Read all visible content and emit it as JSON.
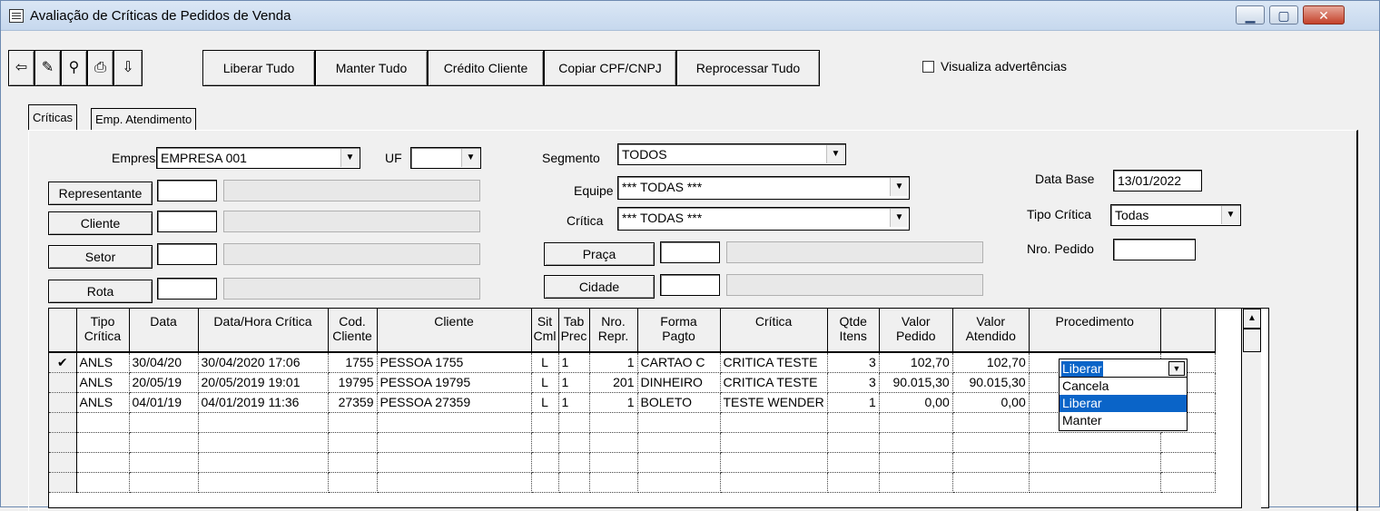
{
  "window": {
    "title": "Avaliação de Críticas de Pedidos de Venda",
    "controls": [
      "minimize-icon",
      "maximize-icon",
      "close-icon"
    ]
  },
  "toolbar": {
    "icons": [
      "exit-icon",
      "edit-icon",
      "binoculars-icon",
      "printer-icon",
      "export-icon"
    ],
    "buttons": [
      "Liberar Tudo",
      "Manter Tudo",
      "Crédito Cliente",
      "Copiar  CPF/CNPJ",
      "Reprocessar Tudo"
    ],
    "checkbox_label": "Visualiza advertências",
    "checkbox_checked": false
  },
  "tabs": [
    "Críticas",
    "Emp. Atendimento"
  ],
  "filters": {
    "empresa_label": "Empresa",
    "empresa_value": "EMPRESA 001",
    "uf_label": "UF",
    "uf_value": "",
    "segmento_label": "Segmento",
    "segmento_value": "TODOS",
    "equipe_label": "Equipe",
    "equipe_value": "*** TODAS ***",
    "critica_label": "Crítica",
    "critica_value": "*** TODAS ***",
    "representante_btn": "Representante",
    "cliente_btn": "Cliente",
    "setor_btn": "Setor",
    "rota_btn": "Rota",
    "praca_btn": "Praça",
    "cidade_btn": "Cidade",
    "data_base_label": "Data Base",
    "data_base_value": "13/01/2022",
    "tipo_critica_label": "Tipo Crítica",
    "tipo_critica_value": "Todas",
    "nro_pedido_label": "Nro. Pedido",
    "nro_pedido_value": ""
  },
  "grid": {
    "headers": [
      [
        "Tipo",
        "Crítica"
      ],
      [
        "Data",
        ""
      ],
      [
        "Data/Hora Crítica",
        ""
      ],
      [
        "Cod.",
        "Cliente"
      ],
      [
        "Cliente",
        ""
      ],
      [
        "Sit",
        "Cml"
      ],
      [
        "Tab",
        "Prec"
      ],
      [
        "Nro.",
        "Repr."
      ],
      [
        "Forma",
        "Pagto"
      ],
      [
        "Crítica",
        ""
      ],
      [
        "Qtde",
        "Itens"
      ],
      [
        "Valor",
        "Pedido"
      ],
      [
        "Valor",
        "Atendido"
      ],
      [
        "Procedimento",
        ""
      ],
      [
        "",
        ""
      ]
    ],
    "rows": [
      {
        "marker": "✔",
        "cells": [
          "ANLS",
          "30/04/20",
          "30/04/2020 17:06",
          "1755",
          "PESSOA 1755",
          "L",
          "1",
          "1",
          "CARTAO C",
          "CRITICA TESTE",
          "3",
          "102,70",
          "102,70",
          "",
          ""
        ]
      },
      {
        "marker": "",
        "cells": [
          "ANLS",
          "20/05/19",
          "20/05/2019 19:01",
          "19795",
          "PESSOA 19795",
          "L",
          "1",
          "201",
          "DINHEIRO",
          "CRITICA TESTE",
          "3",
          "90.015,30",
          "90.015,30",
          "",
          ""
        ]
      },
      {
        "marker": "",
        "cells": [
          "ANLS",
          "04/01/19",
          "04/01/2019 11:36",
          "27359",
          "PESSOA 27359",
          "L",
          "1",
          "1",
          "BOLETO",
          "TESTE WENDER",
          "1",
          "0,00",
          "0,00",
          "",
          ""
        ]
      }
    ],
    "empty_rows": 4
  },
  "procedimento_combo": {
    "value": "Liberar",
    "options": [
      "Cancela",
      "Liberar",
      "Manter"
    ],
    "highlighted": "Liberar"
  }
}
